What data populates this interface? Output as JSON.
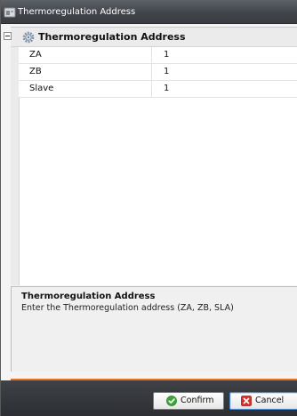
{
  "window": {
    "title": "Thermoregulation Address"
  },
  "grid": {
    "category": "Thermoregulation Address",
    "rows": [
      {
        "name": "ZA",
        "value": "1"
      },
      {
        "name": "ZB",
        "value": "1"
      },
      {
        "name": "Slave",
        "value": "1"
      }
    ]
  },
  "description": {
    "title": "Thermoregulation Address",
    "text": "Enter the Thermoregulation address (ZA, ZB, SLA)"
  },
  "buttons": {
    "confirm": "Confirm",
    "cancel": "Cancel"
  },
  "icons": {
    "title": "app-window-icon",
    "category": "gear-icon",
    "collapse": "collapse-minus-icon",
    "confirm": "check-circle-icon",
    "cancel": "close-box-icon"
  },
  "colors": {
    "accent": "#e8731e",
    "confirm_icon": "#3fa53a",
    "cancel_icon": "#d8302a"
  }
}
